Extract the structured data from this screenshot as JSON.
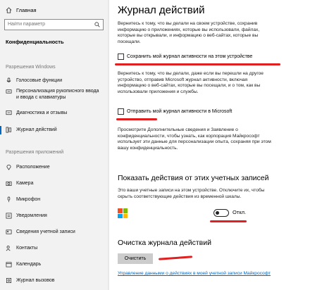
{
  "sidebar": {
    "home_label": "Главная",
    "search_placeholder": "Найти параметр",
    "category_title": "Конфиденциальность",
    "section_windows": "Разрешения Windows",
    "windows_items": [
      {
        "label": "Голосовые функции",
        "icon": "microphone-wave-icon"
      },
      {
        "label": "Персонализация рукописного ввода и ввода с клавиатуры",
        "icon": "pen-keyboard-icon"
      },
      {
        "label": "Диагностика и отзывы",
        "icon": "feedback-icon"
      },
      {
        "label": "Журнал действий",
        "icon": "activity-history-icon"
      }
    ],
    "section_apps": "Разрешения приложений",
    "app_items": [
      {
        "label": "Расположение",
        "icon": "location-icon"
      },
      {
        "label": "Камера",
        "icon": "camera-icon"
      },
      {
        "label": "Микрофон",
        "icon": "microphone-icon"
      },
      {
        "label": "Уведомления",
        "icon": "notifications-icon"
      },
      {
        "label": "Сведения учетной записи",
        "icon": "account-info-icon"
      },
      {
        "label": "Контакты",
        "icon": "contacts-icon"
      },
      {
        "label": "Календарь",
        "icon": "calendar-icon"
      },
      {
        "label": "Журнал вызовов",
        "icon": "call-history-icon"
      }
    ]
  },
  "main": {
    "title": "Журнал действий",
    "para1": "Вернитесь к тому, что вы делали на своем устройстве, сохранив информацию о приложениях, которые вы использовали, файлах, которые вы открывали, и информацию о веб-сайтах, которые вы посещали.",
    "checkbox1_label": "Сохранить мой журнал активности на этом устройстве",
    "para2": "Вернитесь к тому, что вы делали, даже если вы перешли на другое устройство, отправив Microsoft журнал активности, включая информацию о веб-сайтах, которые вы посещали, и о том, как вы использовали приложения и службы.",
    "checkbox2_label": "Отправить мой журнал активности в Microsoft",
    "para3": "Просмотрите Дополнительные сведения и Заявление о конфиденциальности, чтобы узнать, как корпорация Майкрософт использует эти данные для персонализации опыта, сохраняя при этом вашу конфиденциальность.",
    "accounts_heading": "Показать действия от этих учетных записей",
    "accounts_desc": "Это ваши учетные записи на этом устройстве. Отключите их, чтобы скрыть соответствующие действия из временной шкалы.",
    "toggle_label": "Откл.",
    "clear_heading": "Очистка журнала действий",
    "clear_button": "Очистить",
    "manage_link": "Управление данными о действиях в моей учетной записи Майкрософт"
  },
  "colors": {
    "accent": "#0067c0",
    "annotation_red": "#e02020",
    "ms_red": "#f25022",
    "ms_green": "#7fba00",
    "ms_blue": "#00a4ef",
    "ms_yellow": "#ffb900"
  }
}
